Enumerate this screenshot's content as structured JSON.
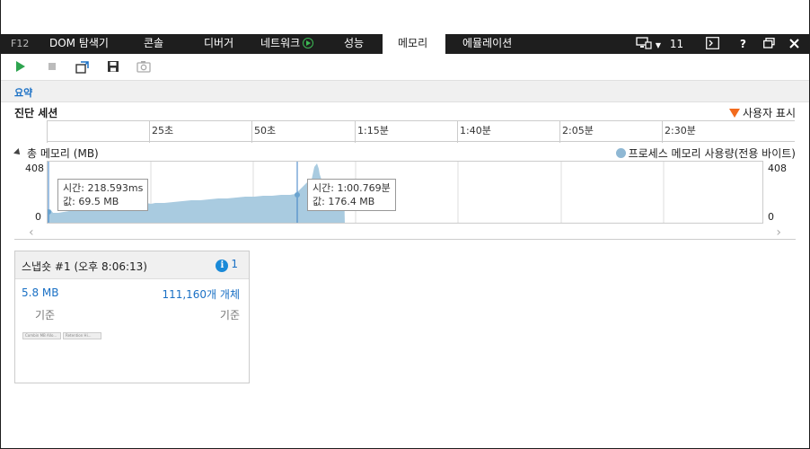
{
  "tabs": {
    "f12": "F12",
    "dom": "DOM 탐색기",
    "console": "콘솔",
    "debugger": "디버거",
    "network": "네트워크",
    "performance": "성능",
    "memory": "메모리",
    "emulation": "에뮬레이션"
  },
  "right_tools": {
    "emulation_count": "11",
    "help": "?"
  },
  "summary": {
    "label": "요약"
  },
  "session": {
    "title": "진단 세션",
    "user_marks": "사용자 표시",
    "ruler_labels": [
      "25초",
      "50초",
      "1:15분",
      "1:40분",
      "2:05분",
      "2:30분"
    ]
  },
  "memory_graph": {
    "title": "총 메모리 (MB)",
    "legend": "프로세스 메모리 사용량(전용 바이트)",
    "y_max": "408",
    "y_min": "0",
    "tooltip1": {
      "time": "시간: 218.593ms",
      "value": "값: 69.5 MB"
    },
    "tooltip2": {
      "time": "시간: 1:00.769분",
      "value": "값: 176.4 MB"
    },
    "colors": {
      "area": "#a9cbe0",
      "marker": "#3b7fc4"
    }
  },
  "snapshot": {
    "title": "스냅숏 #1 (오후 8:06:13)",
    "info_count": "1",
    "size": "5.8 MB",
    "objects": "111,160개 개체",
    "size_sub": "기준",
    "objects_sub": "기준",
    "thumb1": "Combin MB Allo...",
    "thumb2": "Retention Hi..."
  }
}
